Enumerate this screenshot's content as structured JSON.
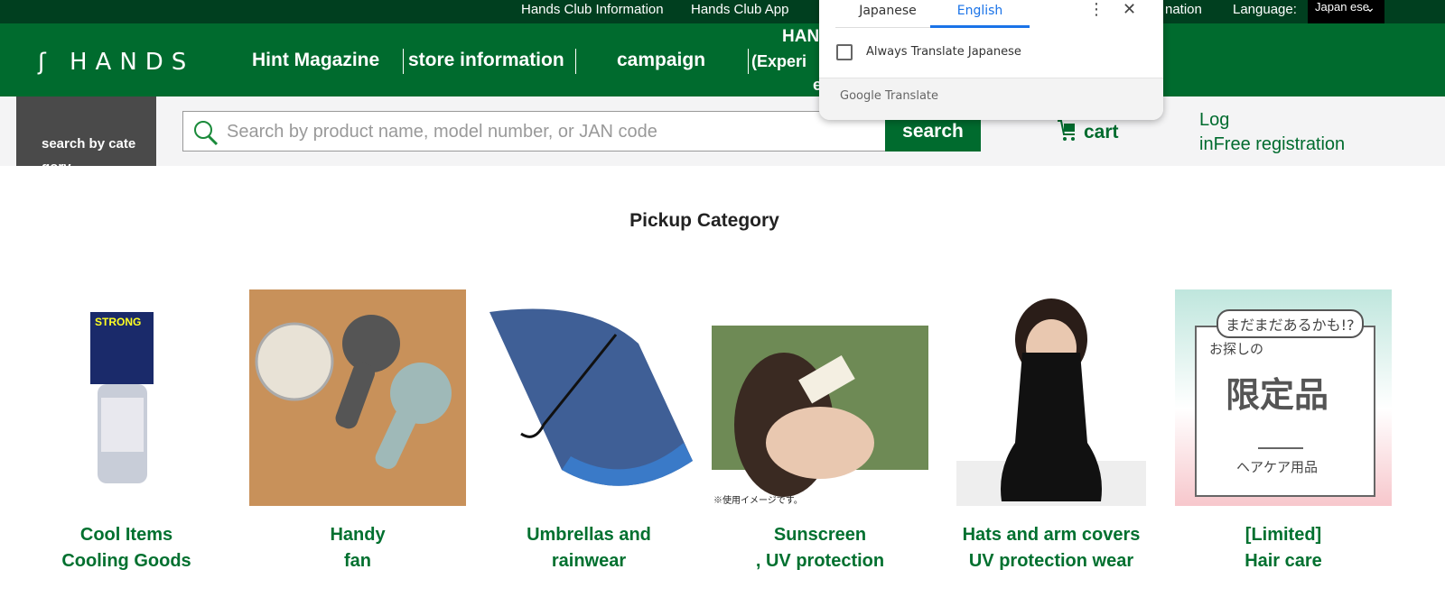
{
  "topbar": {
    "links": [
      "Hands Club Information",
      "Hands Club App",
      "nation"
    ],
    "language_label": "Language:",
    "language_value": "Japan ese"
  },
  "header": {
    "logo": "HANDS",
    "nav": [
      "Hint Magazine",
      "store information",
      "campaign",
      "HAN",
      "(Experi",
      "e"
    ]
  },
  "search": {
    "category_label": "search by cate gory",
    "placeholder": "Search by product name, model number, or JAN code",
    "button": "search"
  },
  "cart": {
    "label": "cart"
  },
  "account": {
    "login": "Log",
    "register": "inFree registration"
  },
  "translate_popup": {
    "tabs": [
      "Japanese",
      "English"
    ],
    "active_tab": "English",
    "checkbox_label": "Always Translate Japanese",
    "checked": false,
    "footer": "Google Translate",
    "accent": "#1a73e8"
  },
  "main": {
    "title": "Pickup Category",
    "items": [
      {
        "line1": "Cool Items",
        "line2": "Cooling Goods"
      },
      {
        "line1": "Handy",
        "line2": "fan"
      },
      {
        "line1": "Umbrellas and",
        "line2": "rainwear"
      },
      {
        "line1": "Sunscreen",
        "line2": ", UV protection",
        "caption": "※使用イメージです。"
      },
      {
        "line1": "Hats and arm covers",
        "line2": "UV protection wear"
      },
      {
        "line1": "[Limited]",
        "line2": "Hair care",
        "banner": [
          "まだまだあるかも!?",
          "お探しの",
          "限定品",
          "ヘアケア用品"
        ]
      }
    ]
  },
  "colors": {
    "brand_green": "#006b2e",
    "topbar": "#003f1f",
    "link_green": "#00702f"
  }
}
